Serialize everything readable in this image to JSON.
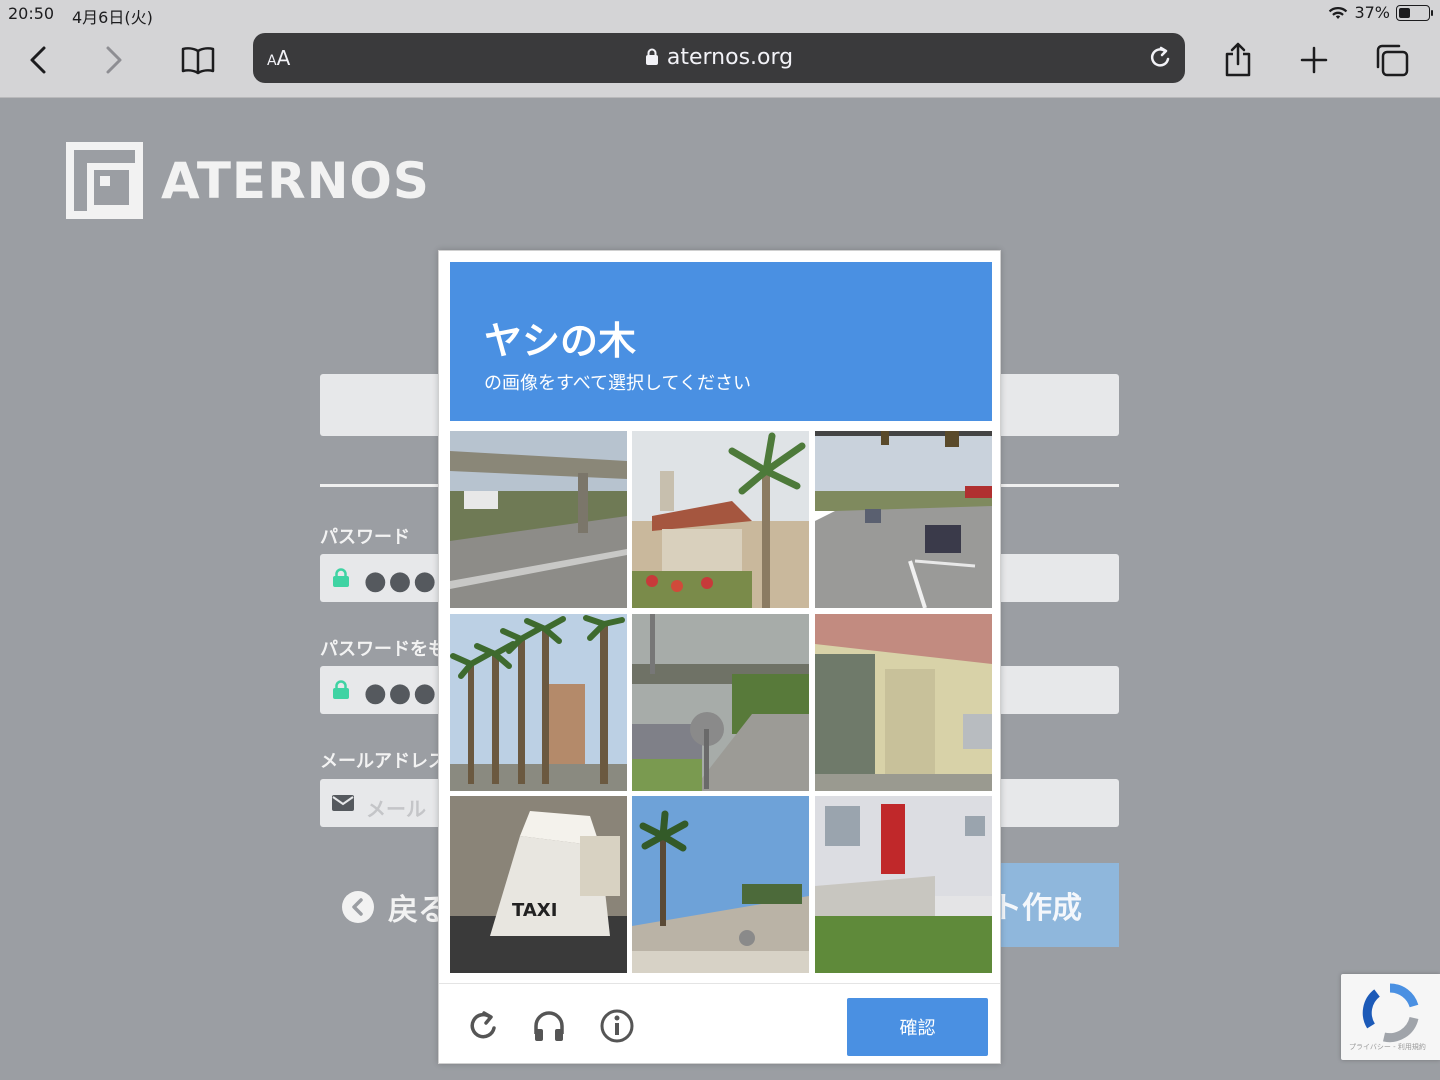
{
  "status_bar": {
    "time": "20:50",
    "date": "4月6日(火)",
    "battery": "37%"
  },
  "browser": {
    "text_size_small": "A",
    "text_size_large": "A",
    "url": "aternos.org"
  },
  "page": {
    "logo_text": "ATERNOS",
    "password_label": "パスワード",
    "password_value": "●●●●",
    "password_repeat_label": "パスワードをも",
    "password_repeat_value": "●●●●",
    "email_label": "メールアドレス",
    "email_placeholder": "メール",
    "back_label": "戻る",
    "create_label": "ト作成"
  },
  "captcha": {
    "keyword": "ヤシの木",
    "instruction": "の画像をすべて選択してください",
    "verify_label": "確認",
    "tiles": [
      {
        "index": 1,
        "scene": "highway-overpass"
      },
      {
        "index": 2,
        "scene": "house-with-palm"
      },
      {
        "index": 3,
        "scene": "street-traffic-lights"
      },
      {
        "index": 4,
        "scene": "palm-tree-row"
      },
      {
        "index": 5,
        "scene": "overpass-parking"
      },
      {
        "index": 6,
        "scene": "building-wall"
      },
      {
        "index": 7,
        "scene": "taxi-sign"
      },
      {
        "index": 8,
        "scene": "palm-rooftop"
      },
      {
        "index": 9,
        "scene": "house-red-door"
      }
    ],
    "taxi_text": "TAXI"
  },
  "recaptcha_badge": {
    "text": "プライバシー - 利用規約"
  },
  "colors": {
    "captcha_blue": "#4a90e2",
    "overlay_gray": "#9b9ea3",
    "field_gray": "#e7e8ea",
    "lock_green": "#3fd3a3"
  }
}
